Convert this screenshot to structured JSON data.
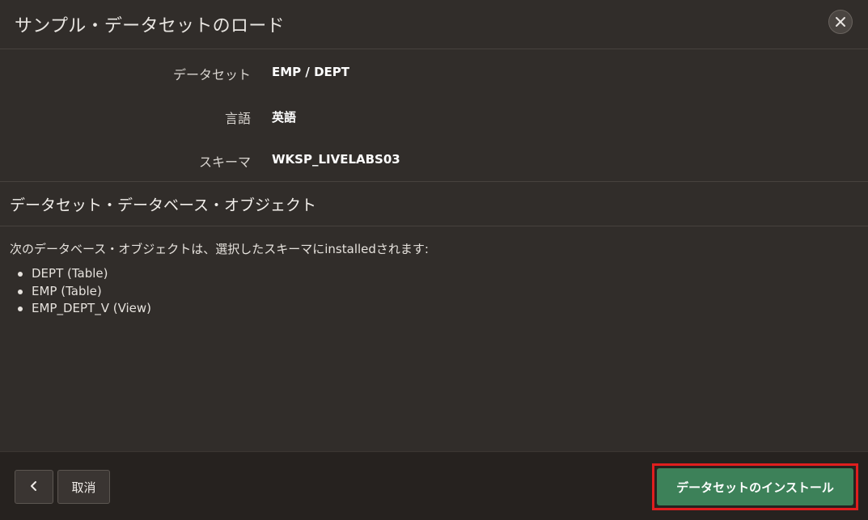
{
  "dialog": {
    "title": "サンプル・データセットのロード",
    "close_icon": "close-icon"
  },
  "fields": [
    {
      "label": "データセット",
      "value": "EMP / DEPT"
    },
    {
      "label": "言語",
      "value": "英語"
    },
    {
      "label": "スキーマ",
      "value": "WKSP_LIVELABS03"
    }
  ],
  "objects_section": {
    "title": "データセット・データベース・オブジェクト",
    "intro": "次のデータベース・オブジェクトは、選択したスキーマにinstalledされます:",
    "items": [
      "DEPT (Table)",
      "EMP (Table)",
      "EMP_DEPT_V (View)"
    ]
  },
  "footer": {
    "back_icon": "chevron-left-icon",
    "cancel_label": "取消",
    "install_label": "データセットのインストール",
    "install_color": "#3d8159",
    "highlight_color": "#e01e1e"
  }
}
